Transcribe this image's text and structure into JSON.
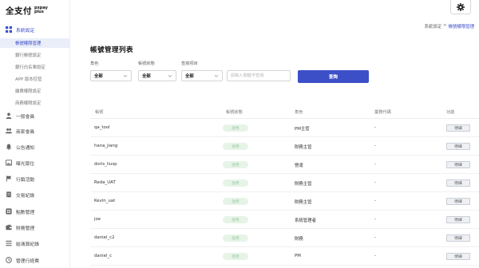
{
  "logo": {
    "main": "全支付",
    "sub": "pxpay plus"
  },
  "settings": {
    "icon": "gear-icon"
  },
  "breadcrumb": {
    "parent": "系統設定",
    "separator": ">",
    "current": "帳號權限管理"
  },
  "sidebar": {
    "groups": [
      {
        "label": "系統設定",
        "icon": "grid-icon",
        "active": true
      },
      {
        "label": "一般會員",
        "icon": "user-icon"
      },
      {
        "label": "商家會員",
        "icon": "users-icon"
      },
      {
        "label": "公告通知",
        "icon": "bell-icon"
      },
      {
        "label": "曝光版位",
        "icon": "image-icon"
      },
      {
        "label": "行銷活動",
        "icon": "flag-icon"
      },
      {
        "label": "交易紀錄",
        "icon": "receipt-icon"
      },
      {
        "label": "點數管理",
        "icon": "coin-icon"
      },
      {
        "label": "財務管理",
        "icon": "wallet-icon"
      },
      {
        "label": "結清算紀錄",
        "icon": "list-icon"
      },
      {
        "label": "管理行經費",
        "icon": "clock-icon"
      }
    ],
    "sub_items": [
      {
        "label": "帳號權限管理",
        "active": true
      },
      {
        "label": "銀行帳號設定"
      },
      {
        "label": "銀行白名單設定"
      },
      {
        "label": "APP 版本控管"
      },
      {
        "label": "繳費權限設定"
      },
      {
        "label": "商務權限設定"
      }
    ]
  },
  "page": {
    "title": "帳號管理列表"
  },
  "filters": {
    "role": {
      "label": "角色",
      "value": "全部"
    },
    "status": {
      "label": "帳號狀態",
      "value": "全部"
    },
    "query_field": {
      "label": "查詢項目",
      "value": "全部"
    },
    "search_placeholder": "請輸入關鍵字查詢",
    "search_button": "查詢"
  },
  "table": {
    "columns": [
      "帳號",
      "帳號狀態",
      "角色",
      "業務代碼",
      "功能"
    ],
    "rows": [
      {
        "account": "qa_tool",
        "status": "啟用",
        "role": "PM主管",
        "code": "-",
        "action": "明細"
      },
      {
        "account": "hana_jiang",
        "status": "啟用",
        "role": "財務主管",
        "code": "-",
        "action": "明細"
      },
      {
        "account": "doris_liusp",
        "status": "啟用",
        "role": "營運",
        "code": "-",
        "action": "明細"
      },
      {
        "account": "Reda_UAT",
        "status": "啟用",
        "role": "財務主管",
        "code": "-",
        "action": "明細"
      },
      {
        "account": "Kevin_uat",
        "status": "啟用",
        "role": "財務主管",
        "code": "-",
        "action": "明細"
      },
      {
        "account": "joe",
        "status": "啟用",
        "role": "系統管理者",
        "code": "-",
        "action": "明細"
      },
      {
        "account": "daniel_c2",
        "status": "啟用",
        "role": "財務",
        "code": "-",
        "action": "明細"
      },
      {
        "account": "daniel_c",
        "status": "啟用",
        "role": "PM",
        "code": "-",
        "action": "明細"
      }
    ]
  },
  "colors": {
    "accent": "#3d4fc7",
    "badge_bg": "#e6f4e8",
    "badge_text": "#9bc8a2"
  }
}
